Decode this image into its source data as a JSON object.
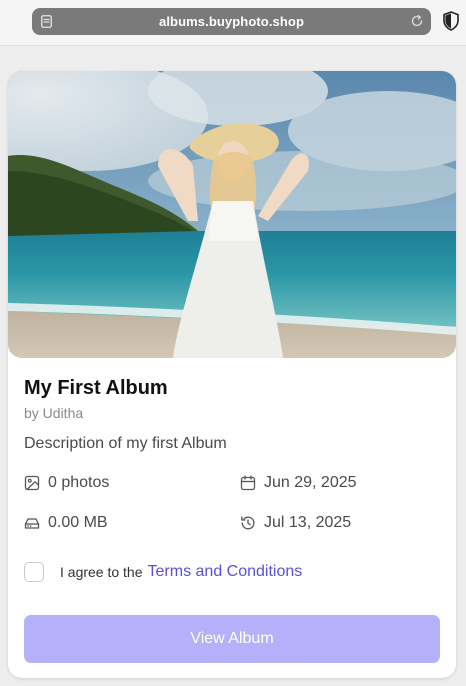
{
  "browser": {
    "url": "albums.buyphoto.shop"
  },
  "album": {
    "title": "My First Album",
    "owner": "by Uditha",
    "description": "Description of my first Album",
    "photos": "0 photos",
    "created": "Jun 29, 2025",
    "size": "0.00 MB",
    "updated": "Jul 13, 2025",
    "terms_prefix": "I agree to the",
    "terms_link": "Terms and Conditions",
    "view_button": "View Album",
    "terms_checked": false
  },
  "icons": {
    "photos": "image-icon",
    "created": "calendar-icon",
    "size": "hard-drive-icon",
    "updated": "history-icon"
  },
  "colors": {
    "accent": "#5b4fd6",
    "button": "#b5b0fa"
  }
}
